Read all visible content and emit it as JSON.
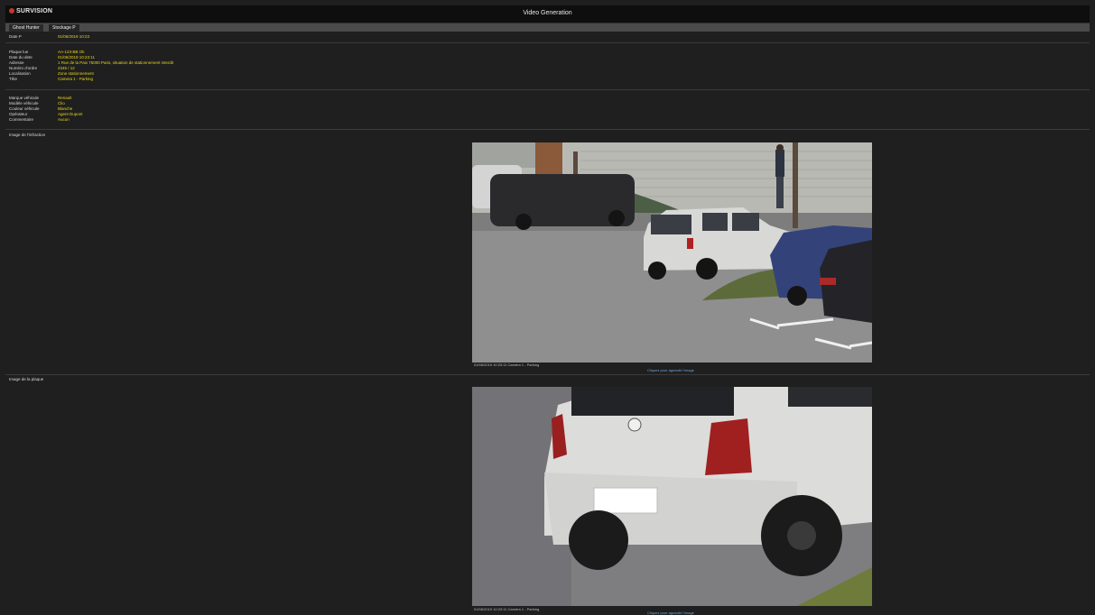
{
  "header": {
    "logo": "SURVISION",
    "title": "Video Generation"
  },
  "tabs": [
    "Ghost Hunter",
    "Stockage P"
  ],
  "info": {
    "top": [
      {
        "k": "Date P",
        "v": "01/06/2019 10:23"
      }
    ],
    "block1": [
      {
        "k": "Plaque lue",
        "v": "AA-123-BB Ok"
      },
      {
        "k": "Date du dete",
        "v": "01/06/2019 10:23:11"
      },
      {
        "k": "Adresse",
        "v": "1 Rue de la Paix 75000 Paris, situation de stationnement interdit"
      },
      {
        "k": "Numéro d'ordre",
        "v": "2345 / 12"
      },
      {
        "k": "Localisation",
        "v": "Zone stationnement"
      },
      {
        "k": "Tête",
        "v": "Camera 1 - Parking"
      }
    ],
    "block2": [
      {
        "k": "Marque véhicule",
        "v": "Renault"
      },
      {
        "k": "Modèle véhicule",
        "v": "Clio"
      },
      {
        "k": "Couleur véhicule",
        "v": "Blanche"
      },
      {
        "k": "Opérateur",
        "v": "Agent Dupont"
      },
      {
        "k": "Commentaire",
        "v": "Aucun"
      }
    ]
  },
  "sections": {
    "context": "Image de l'infraction",
    "plate": "Image de la plaque"
  },
  "images": {
    "context_caption": "01/06/2019 10:23:11   Caméra 1 - Parking",
    "context_link": "Cliquez pour agrandir l'image",
    "plate_caption": "01/06/2019 10:23:11   Caméra 1 - Parking",
    "plate_link": "Cliquez pour agrandir l'image"
  },
  "colors": {
    "value": "#e8d41a",
    "label": "#d8d8d8",
    "background": "#1f1f1f"
  }
}
